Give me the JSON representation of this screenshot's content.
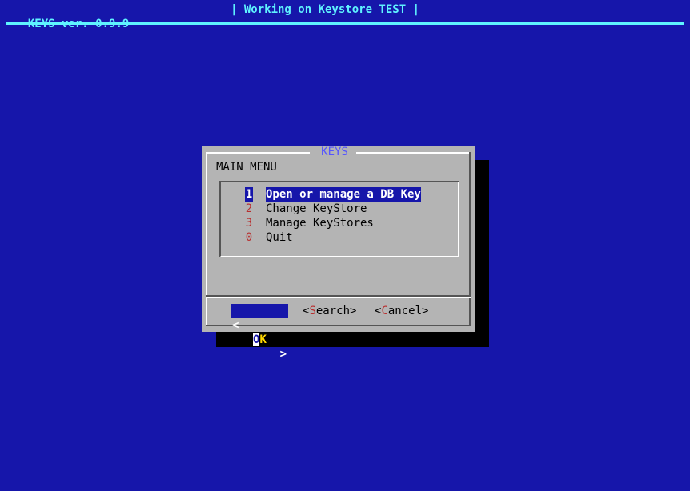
{
  "backtitle": {
    "app": "KEYS ver. 0.9.9",
    "status": "| Working on Keystore TEST |"
  },
  "dialog": {
    "title": "KEYS",
    "prompt": "MAIN MENU",
    "items": [
      {
        "tag": "1",
        "label": "Open or manage a DB Key",
        "selected": true
      },
      {
        "tag": "2",
        "label": "Change KeyStore",
        "selected": false
      },
      {
        "tag": "3",
        "label": "Manage KeyStores",
        "selected": false
      },
      {
        "tag": "0",
        "label": "Quit",
        "selected": false
      }
    ],
    "buttons": {
      "ok": {
        "open": "<",
        "hot": "O",
        "rest": "K",
        "close": ">"
      },
      "search": {
        "open": "<",
        "hot": "S",
        "rest": "earch",
        "close": ">"
      },
      "cancel": {
        "open": "<",
        "hot": "C",
        "rest": "ancel",
        "close": ">"
      }
    }
  },
  "colors": {
    "background": "#1616aa",
    "backtitle": "#5ff3ff",
    "dialog": "#b4b4b4",
    "title": "#5555ff",
    "tag": "#b82d2d",
    "highlight": "#1616aa"
  }
}
